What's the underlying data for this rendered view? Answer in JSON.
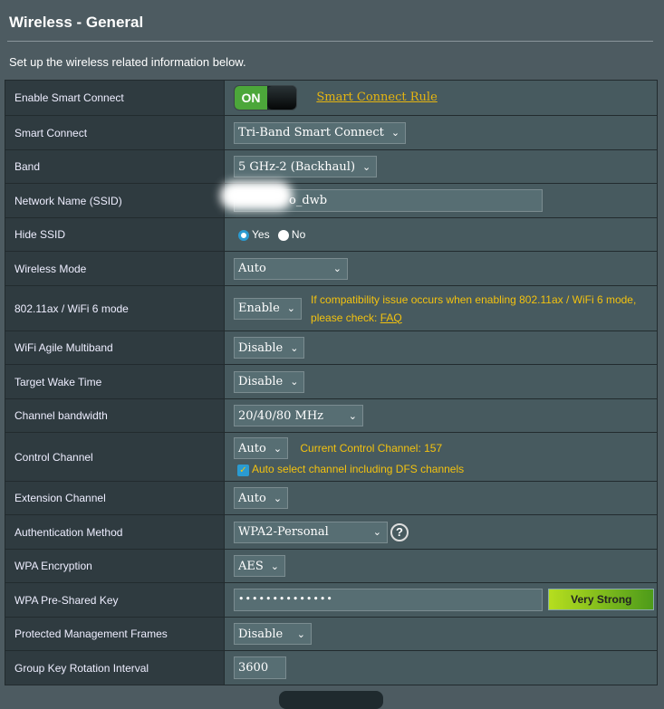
{
  "header": {
    "title": "Wireless - General",
    "description": "Set up the wireless related information below."
  },
  "rows": {
    "smart_connect_enable": {
      "label": "Enable Smart Connect",
      "toggle": "ON",
      "link": "Smart Connect Rule"
    },
    "smart_connect": {
      "label": "Smart Connect",
      "value": "Tri-Band Smart Connect"
    },
    "band": {
      "label": "Band",
      "value": "5 GHz-2 (Backhaul)"
    },
    "ssid": {
      "label": "Network Name (SSID)",
      "value": "o_dwb"
    },
    "hide_ssid": {
      "label": "Hide SSID",
      "yes": "Yes",
      "no": "No",
      "selected": "Yes"
    },
    "wireless_mode": {
      "label": "Wireless Mode",
      "value": "Auto"
    },
    "ax_mode": {
      "label": "802.11ax / WiFi 6 mode",
      "value": "Enable",
      "note": "If compatibility issue occurs when enabling 802.11ax / WiFi 6 mode,",
      "note2": "please check: ",
      "faq": "FAQ"
    },
    "agile": {
      "label": "WiFi Agile Multiband",
      "value": "Disable"
    },
    "twt": {
      "label": "Target Wake Time",
      "value": "Disable"
    },
    "bandwidth": {
      "label": "Channel bandwidth",
      "value": "20/40/80 MHz"
    },
    "control_channel": {
      "label": "Control Channel",
      "value": "Auto",
      "current": "Current Control Channel: 157",
      "dfs": "Auto select channel including DFS channels",
      "dfs_checked": true
    },
    "ext_channel": {
      "label": "Extension Channel",
      "value": "Auto"
    },
    "auth": {
      "label": "Authentication Method",
      "value": "WPA2-Personal",
      "help": "?"
    },
    "wpa_enc": {
      "label": "WPA Encryption",
      "value": "AES"
    },
    "psk": {
      "label": "WPA Pre-Shared Key",
      "value": "••••••••••••••",
      "strength": "Very Strong"
    },
    "pmf": {
      "label": "Protected Management Frames",
      "value": "Disable"
    },
    "gkri": {
      "label": "Group Key Rotation Interval",
      "value": "3600"
    }
  },
  "colors": {
    "accent_yellow": "#f3c20f",
    "toggle_green": "#4ca73a",
    "radio_blue": "#2a9bd1"
  }
}
